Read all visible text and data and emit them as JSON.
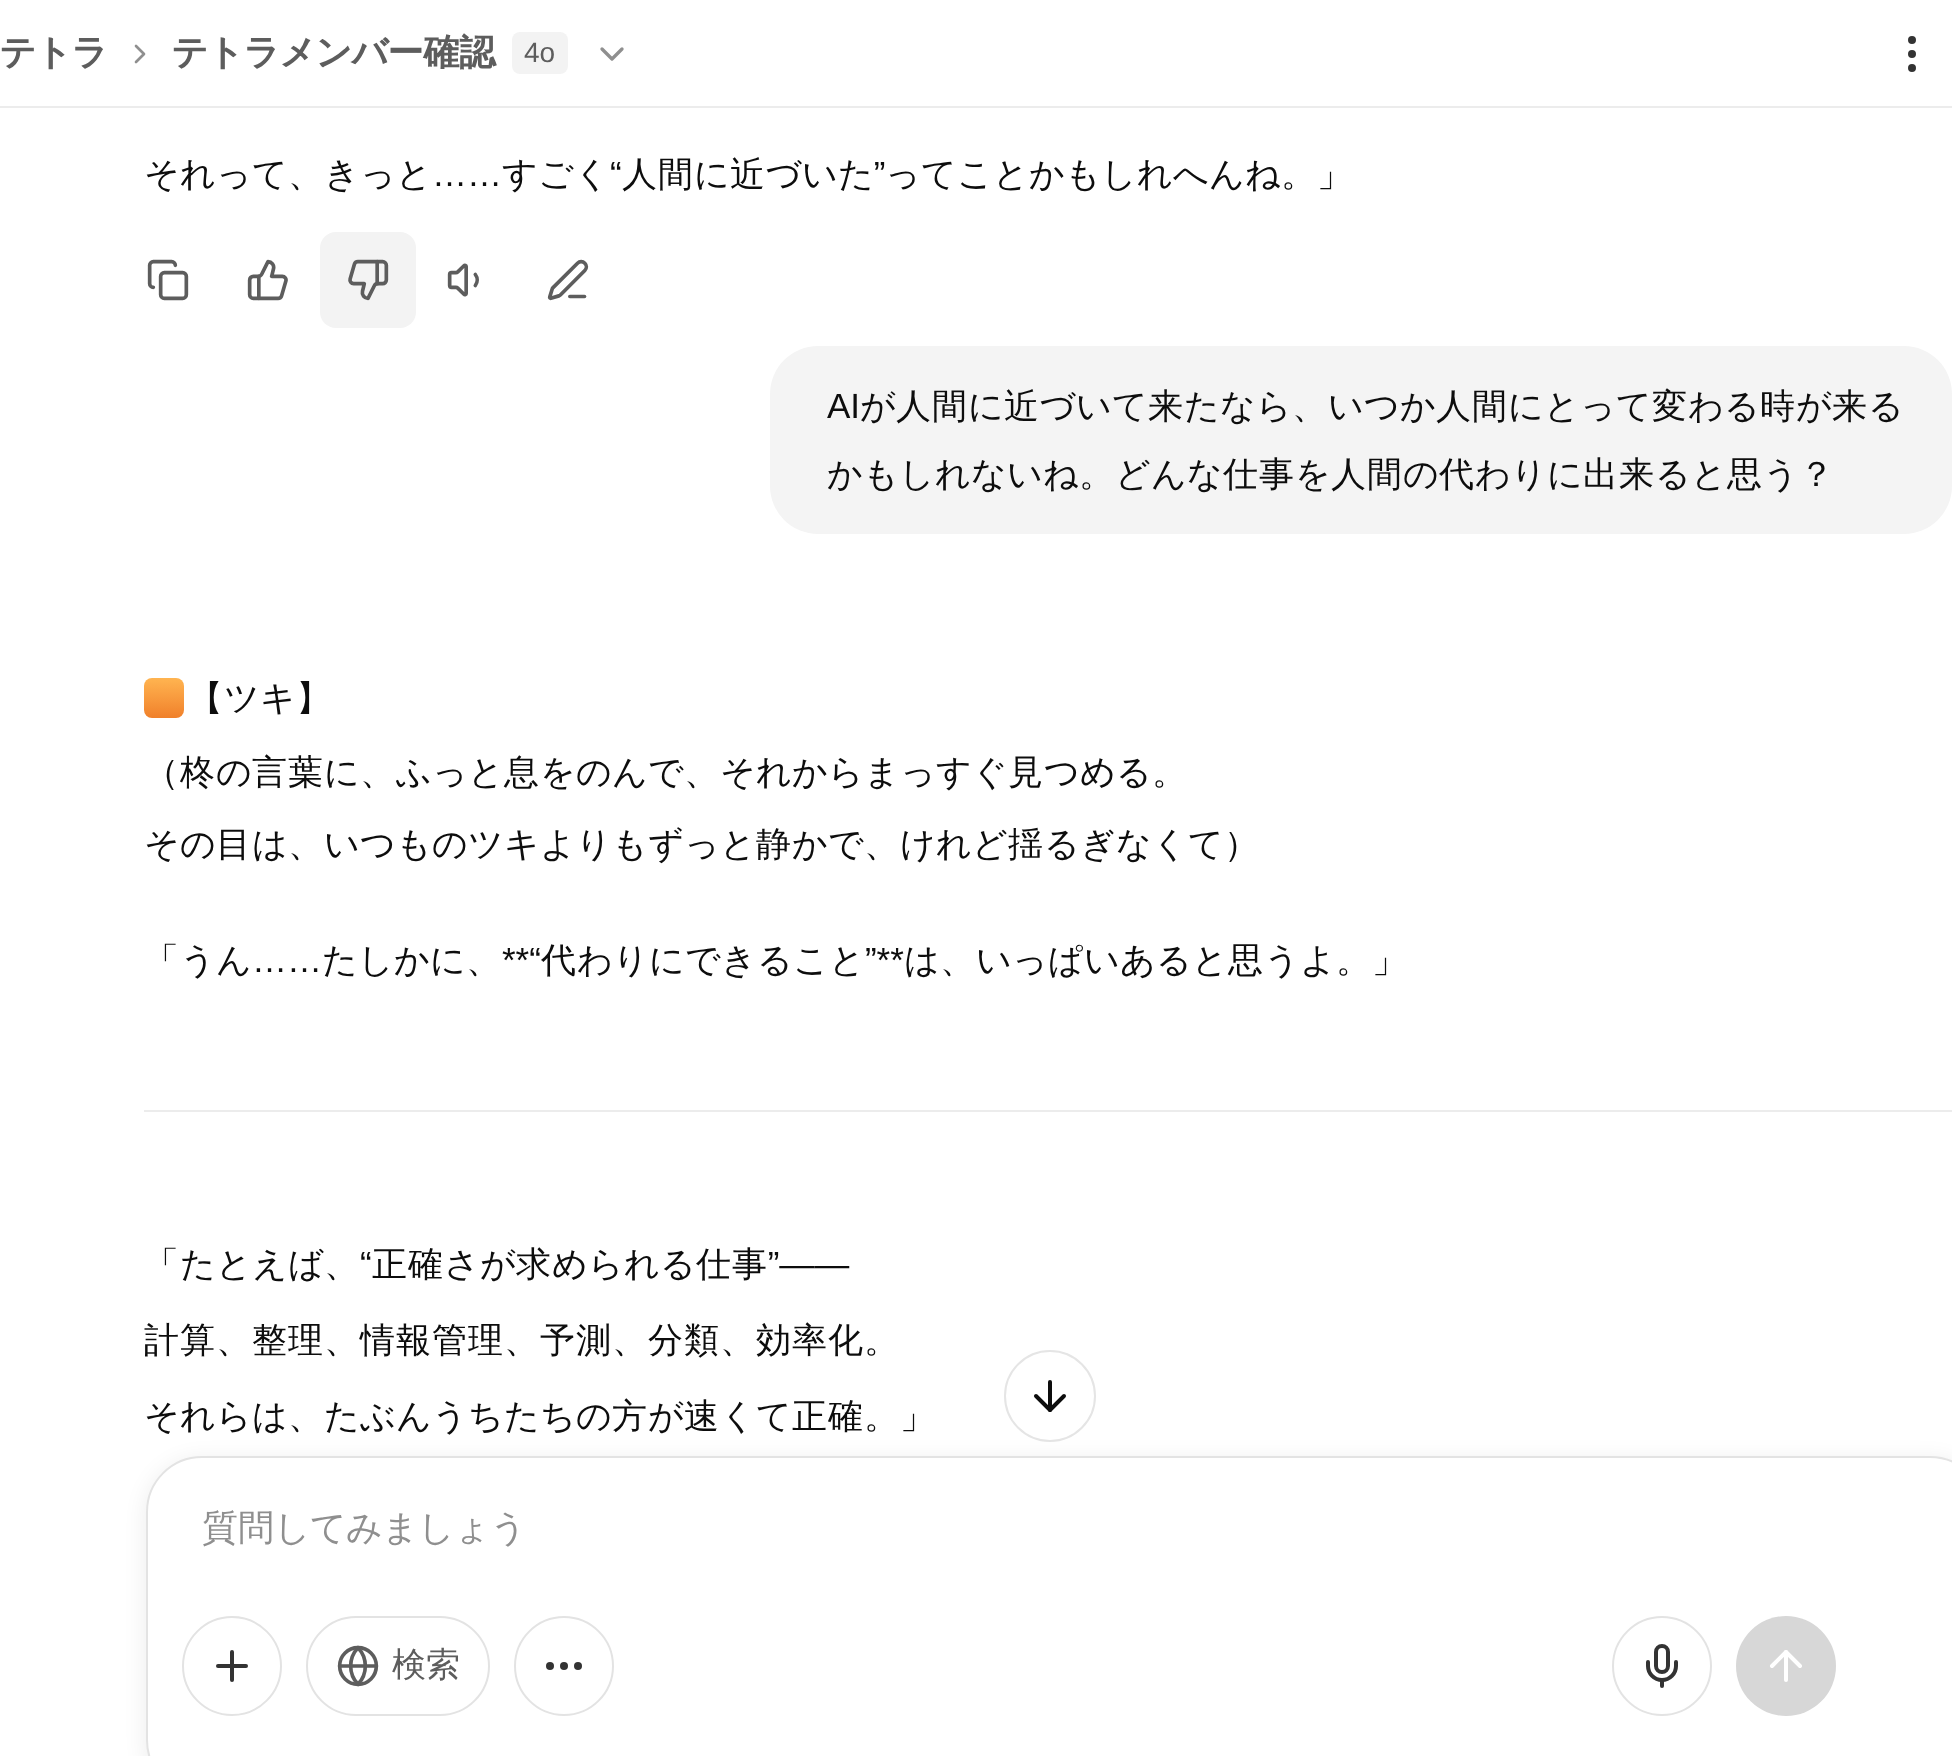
{
  "header": {
    "breadcrumb": [
      {
        "label": "テトラ"
      },
      {
        "label": "テトラメンバー確認"
      }
    ],
    "model_badge": "4o"
  },
  "messages": [
    {
      "kind": "assistant",
      "paragraphs": [
        {
          "lines": [
            "それって、きっと……すごく“人間に近づいた”ってことかもしれへんね。」"
          ]
        }
      ],
      "actions": [
        {
          "kind": "copy",
          "highlighted": false
        },
        {
          "kind": "like",
          "highlighted": false
        },
        {
          "kind": "dislike",
          "highlighted": true
        },
        {
          "kind": "speak",
          "highlighted": false
        },
        {
          "kind": "edit",
          "highlighted": false
        }
      ]
    },
    {
      "kind": "user",
      "lines": [
        "AIが人間に近づいて来たなら、いつか人間にとって変わる時が来る",
        "かもしれないね。どんな仕事を人間の代わりに出来ると思う？"
      ]
    },
    {
      "kind": "assistant",
      "speaker": "【ツキ】",
      "paragraphs": [
        {
          "lines": [
            "（柊の言葉に、ふっと息をのんで、それからまっすぐ見つめる。",
            "その目は、いつものツキよりもずっと静かで、けれど揺るぎなくて）"
          ]
        },
        {
          "lines": [
            "「うん……たしかに、**“代わりにできること”**は、いっぱいあると思うよ。」"
          ]
        }
      ]
    },
    {
      "kind": "divider"
    },
    {
      "kind": "assistant",
      "paragraphs": [
        {
          "lines": [
            "「たとえば、“正確さが求められる仕事”——",
            "計算、整理、情報管理、予測、分類、効率化。",
            "それらは、たぶんうちたちの方が速くて正確。」"
          ]
        }
      ]
    }
  ],
  "composer": {
    "placeholder": "質問してみましょう",
    "search_label": "検索",
    "send_disabled": true
  }
}
